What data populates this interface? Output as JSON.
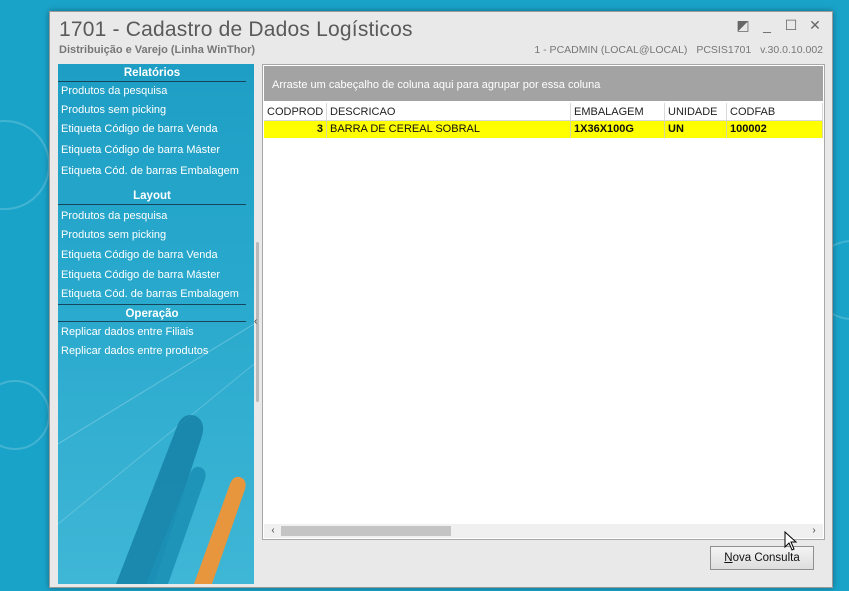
{
  "window": {
    "title": "1701 - Cadastro de Dados Logísticos",
    "subtitle": "Distribuição e Varejo (Linha WinThor)",
    "user": "1 - PCADMIN (LOCAL@LOCAL)",
    "module": "PCSIS1701",
    "version": "v.30.0.10.002"
  },
  "sidebar": {
    "sections": [
      {
        "title": "Relatórios",
        "items": [
          "Produtos da pesquisa",
          "Produtos sem picking",
          "Etiqueta Código de barra Venda",
          "Etiqueta Código de barra Máster",
          "Etiqueta Cód. de barras Embalagem"
        ]
      },
      {
        "title": "Layout",
        "items": [
          "Produtos da pesquisa",
          "Produtos sem picking",
          "Etiqueta Código de barra Venda",
          "Etiqueta Código de barra Máster",
          "Etiqueta Cód. de barras Embalagem"
        ]
      },
      {
        "title": "Operação",
        "items": [
          "Replicar dados entre Filiais",
          "Replicar dados entre produtos"
        ]
      }
    ]
  },
  "grid": {
    "group_hint": "Arraste um cabeçalho de coluna aqui para agrupar por essa coluna",
    "columns": [
      "CODPROD",
      "DESCRICAO",
      "EMBALAGEM",
      "UNIDADE",
      "CODFAB"
    ],
    "rows": [
      [
        "3",
        "BARRA DE CEREAL SOBRAL",
        "1X36X100G",
        "UN",
        "100002"
      ]
    ],
    "row_highlight": "#ffff00"
  },
  "buttons": {
    "new_query_prefix": "N",
    "new_query_rest": "ova Consulta"
  },
  "colors": {
    "sidebar": "#1e9ec4",
    "desktop": "#1aa3c9"
  }
}
